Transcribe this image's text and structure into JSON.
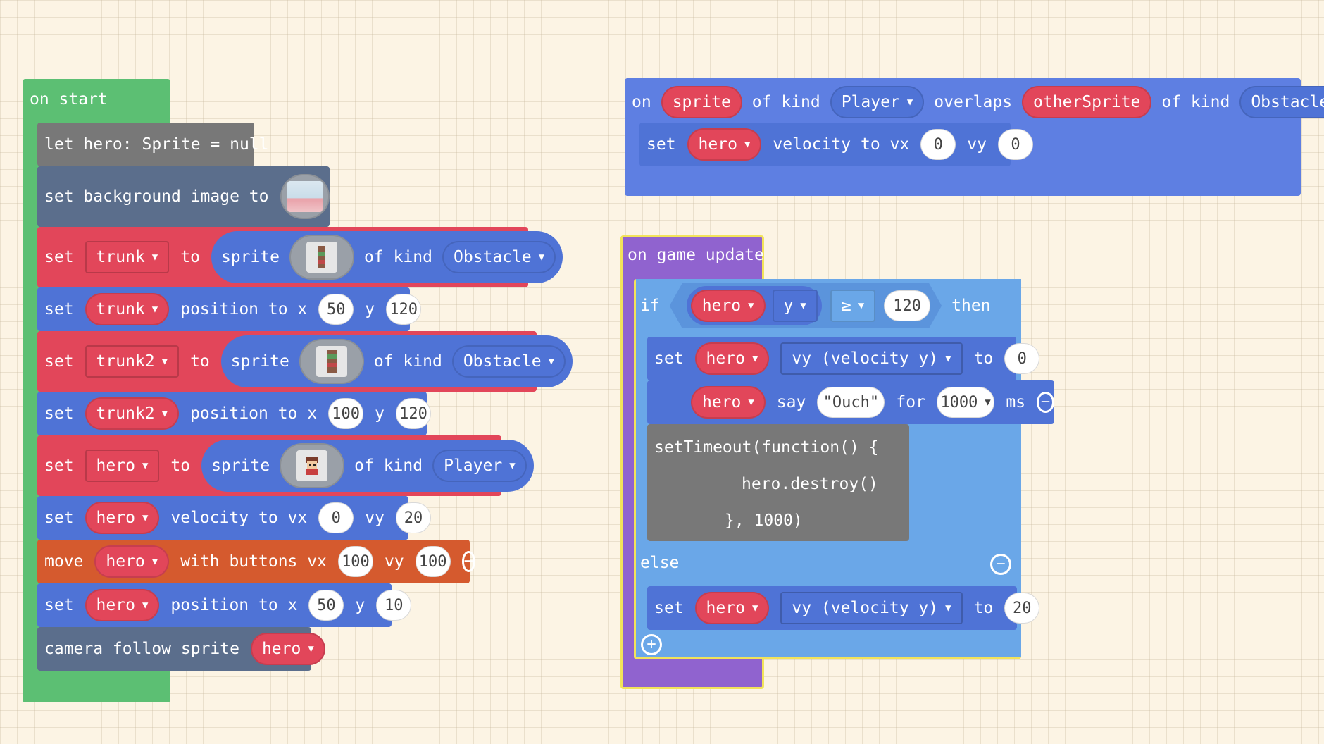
{
  "on_start": {
    "header": "on start",
    "let_stmt": "let hero: Sprite = null",
    "bg": {
      "label": "set background image to"
    },
    "row_trunk": {
      "set": "set",
      "var": "trunk",
      "to": "to",
      "sprite": "sprite",
      "of_kind": "of kind",
      "kind": "Obstacle"
    },
    "row_trunk_pos": {
      "set": "set",
      "var": "trunk",
      "position_to_x": "position to x",
      "x": "50",
      "y_label": "y",
      "y": "120"
    },
    "row_trunk2": {
      "set": "set",
      "var": "trunk2",
      "to": "to",
      "sprite": "sprite",
      "of_kind": "of kind",
      "kind": "Obstacle"
    },
    "row_trunk2_pos": {
      "set": "set",
      "var": "trunk2",
      "position_to_x": "position to x",
      "x": "100",
      "y_label": "y",
      "y": "120"
    },
    "row_hero": {
      "set": "set",
      "var": "hero",
      "to": "to",
      "sprite": "sprite",
      "of_kind": "of kind",
      "kind": "Player"
    },
    "row_hero_vel": {
      "set": "set",
      "var": "hero",
      "velocity_to_vx": "velocity to vx",
      "vx": "0",
      "vy_label": "vy",
      "vy": "20"
    },
    "row_move": {
      "move": "move",
      "var": "hero",
      "with_buttons_vx": "with buttons vx",
      "vx": "100",
      "vy_label": "vy",
      "vy": "100"
    },
    "row_hero_pos": {
      "set": "set",
      "var": "hero",
      "position_to_x": "position to x",
      "x": "50",
      "y_label": "y",
      "y": "10"
    },
    "row_camera": {
      "label": "camera follow sprite",
      "var": "hero"
    }
  },
  "overlap": {
    "on": "on",
    "sprite": "sprite",
    "of_kind1": "of kind",
    "kind1": "Player",
    "overlaps": "overlaps",
    "other": "otherSprite",
    "of_kind2": "of kind",
    "kind2": "Obstacle",
    "body": {
      "set": "set",
      "var": "hero",
      "velocity_to_vx": "velocity to vx",
      "vx": "0",
      "vy_label": "vy",
      "vy": "0"
    }
  },
  "game_update": {
    "header": "on game update",
    "if": "if",
    "cond": {
      "var": "hero",
      "prop": "y",
      "op": "≥",
      "value": "120"
    },
    "then": "then",
    "set1": {
      "set": "set",
      "var": "hero",
      "prop": "vy (velocity y)",
      "to": "to",
      "value": "0"
    },
    "say": {
      "var": "hero",
      "say": "say",
      "text": "\"Ouch\"",
      "for": "for",
      "ms_value": "1000",
      "ms": "ms"
    },
    "code": {
      "line1": "setTimeout(function() {",
      "line2": "hero.destroy()",
      "line3": "}, 1000)"
    },
    "else": "else",
    "set2": {
      "set": "set",
      "var": "hero",
      "prop": "vy (velocity y)",
      "to": "to",
      "value": "20"
    }
  },
  "colors": {
    "green": "#5cbf73",
    "blue": "#4f73d6",
    "red": "#e2465a",
    "gray": "#787878",
    "slate": "#5b6e8c",
    "orange": "#d55a2e",
    "purple": "#9063cf",
    "lightblue": "#6aa7e8",
    "overlap_blue": "#5e7fe2"
  }
}
